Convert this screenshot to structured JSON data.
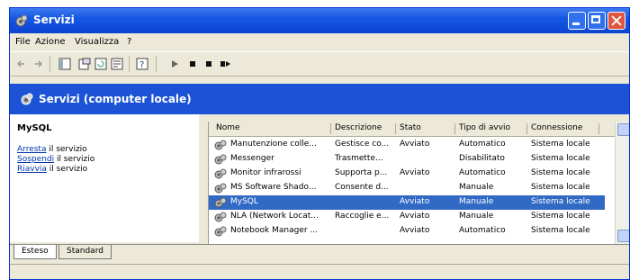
{
  "window": {
    "title": "Servizi"
  },
  "menu": [
    "File",
    "Azione",
    "Visualizza",
    "?"
  ],
  "banner": {
    "title": "Servizi (computer locale)"
  },
  "left_pane": {
    "service_name": "MySQL",
    "actions": [
      {
        "link": "Arresta",
        "text": " il servizio"
      },
      {
        "link": "Sospendi",
        "text": " il servizio"
      },
      {
        "link": "Riavvia",
        "text": " il servizio"
      }
    ]
  },
  "table": {
    "columns": [
      "Nome",
      "Descrizione",
      "Stato",
      "Tipo di avvio",
      "Connessione"
    ],
    "rows": [
      [
        "Manutenzione colle...",
        "Gestisce co...",
        "Avviato",
        "Automatico",
        "Sistema locale"
      ],
      [
        "Messenger",
        "Trasmette...",
        "",
        "Disabilitato",
        "Sistema locale"
      ],
      [
        "Monitor infrarossi",
        "Supporta p...",
        "Avviato",
        "Automatico",
        "Sistema locale"
      ],
      [
        "MS Software Shado...",
        "Consente d...",
        "",
        "Manuale",
        "Sistema locale"
      ],
      [
        "MySQL",
        "",
        "Avviato",
        "Manuale",
        "Sistema locale"
      ],
      [
        "NLA (Network Locat...",
        "Raccoglie e...",
        "Avviato",
        "Manuale",
        "Sistema locale"
      ],
      [
        "Notebook Manager ...",
        "",
        "Avviato",
        "Automatico",
        "Sistema locale"
      ]
    ],
    "selected_index": 4
  },
  "tabs": [
    "Esteso",
    "Standard"
  ],
  "colors": {
    "title_blue": "#1557e3",
    "selection": "#316ac5",
    "link": "#0035ad"
  }
}
